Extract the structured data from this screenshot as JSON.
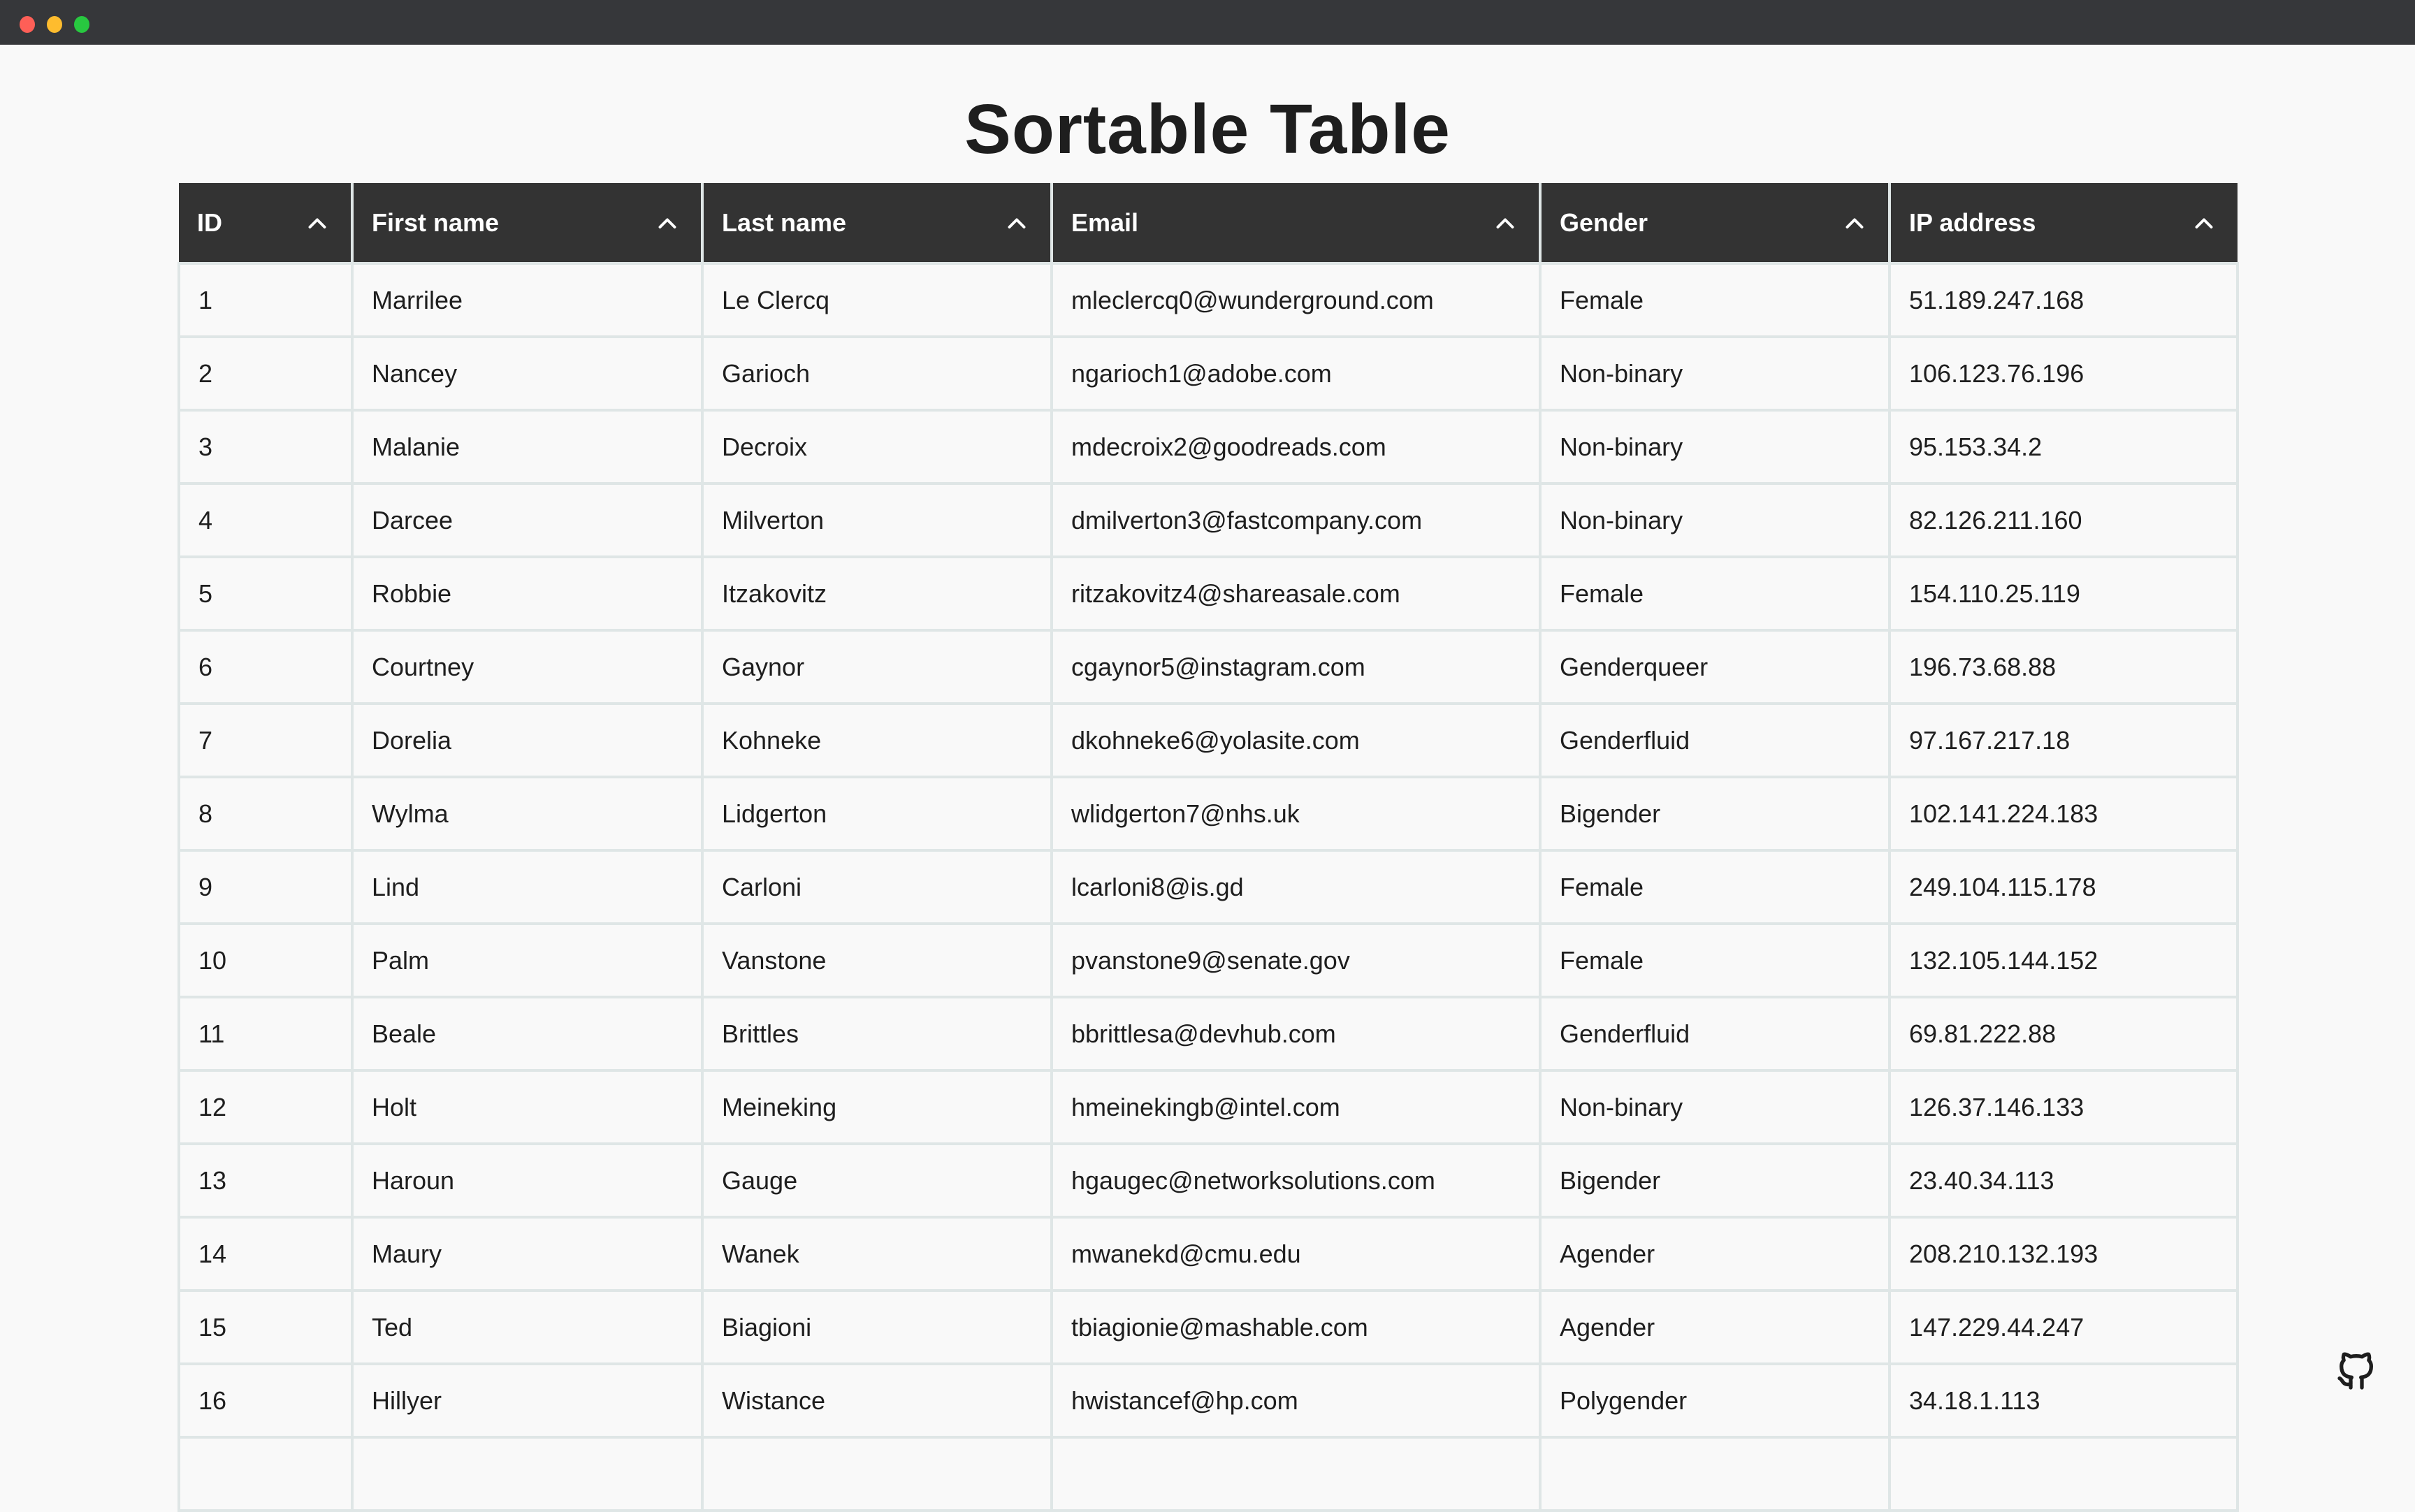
{
  "title": "Sortable Table",
  "columns": [
    "ID",
    "First name",
    "Last name",
    "Email",
    "Gender",
    "IP address"
  ],
  "rows": [
    [
      "1",
      "Marrilee",
      "Le Clercq",
      "mleclercq0@wunderground.com",
      "Female",
      "51.189.247.168"
    ],
    [
      "2",
      "Nancey",
      "Garioch",
      "ngarioch1@adobe.com",
      "Non-binary",
      "106.123.76.196"
    ],
    [
      "3",
      "Malanie",
      "Decroix",
      "mdecroix2@goodreads.com",
      "Non-binary",
      "95.153.34.2"
    ],
    [
      "4",
      "Darcee",
      "Milverton",
      "dmilverton3@fastcompany.com",
      "Non-binary",
      "82.126.211.160"
    ],
    [
      "5",
      "Robbie",
      "Itzakovitz",
      "ritzakovitz4@shareasale.com",
      "Female",
      "154.110.25.119"
    ],
    [
      "6",
      "Courtney",
      "Gaynor",
      "cgaynor5@instagram.com",
      "Genderqueer",
      "196.73.68.88"
    ],
    [
      "7",
      "Dorelia",
      "Kohneke",
      "dkohneke6@yolasite.com",
      "Genderfluid",
      "97.167.217.18"
    ],
    [
      "8",
      "Wylma",
      "Lidgerton",
      "wlidgerton7@nhs.uk",
      "Bigender",
      "102.141.224.183"
    ],
    [
      "9",
      "Lind",
      "Carloni",
      "lcarloni8@is.gd",
      "Female",
      "249.104.115.178"
    ],
    [
      "10",
      "Palm",
      "Vanstone",
      "pvanstone9@senate.gov",
      "Female",
      "132.105.144.152"
    ],
    [
      "11",
      "Beale",
      "Brittles",
      "bbrittlesa@devhub.com",
      "Genderfluid",
      "69.81.222.88"
    ],
    [
      "12",
      "Holt",
      "Meineking",
      "hmeinekingb@intel.com",
      "Non-binary",
      "126.37.146.133"
    ],
    [
      "13",
      "Haroun",
      "Gauge",
      "hgaugec@networksolutions.com",
      "Bigender",
      "23.40.34.113"
    ],
    [
      "14",
      "Maury",
      "Wanek",
      "mwanekd@cmu.edu",
      "Agender",
      "208.210.132.193"
    ],
    [
      "15",
      "Ted",
      "Biagioni",
      "tbiagionie@mashable.com",
      "Agender",
      "147.229.44.247"
    ],
    [
      "16",
      "Hillyer",
      "Wistance",
      "hwistancef@hp.com",
      "Polygender",
      "34.18.1.113"
    ]
  ],
  "colors": {
    "header_bg": "#333333",
    "titlebar": "#36373a",
    "border": "#dfe6e6"
  }
}
